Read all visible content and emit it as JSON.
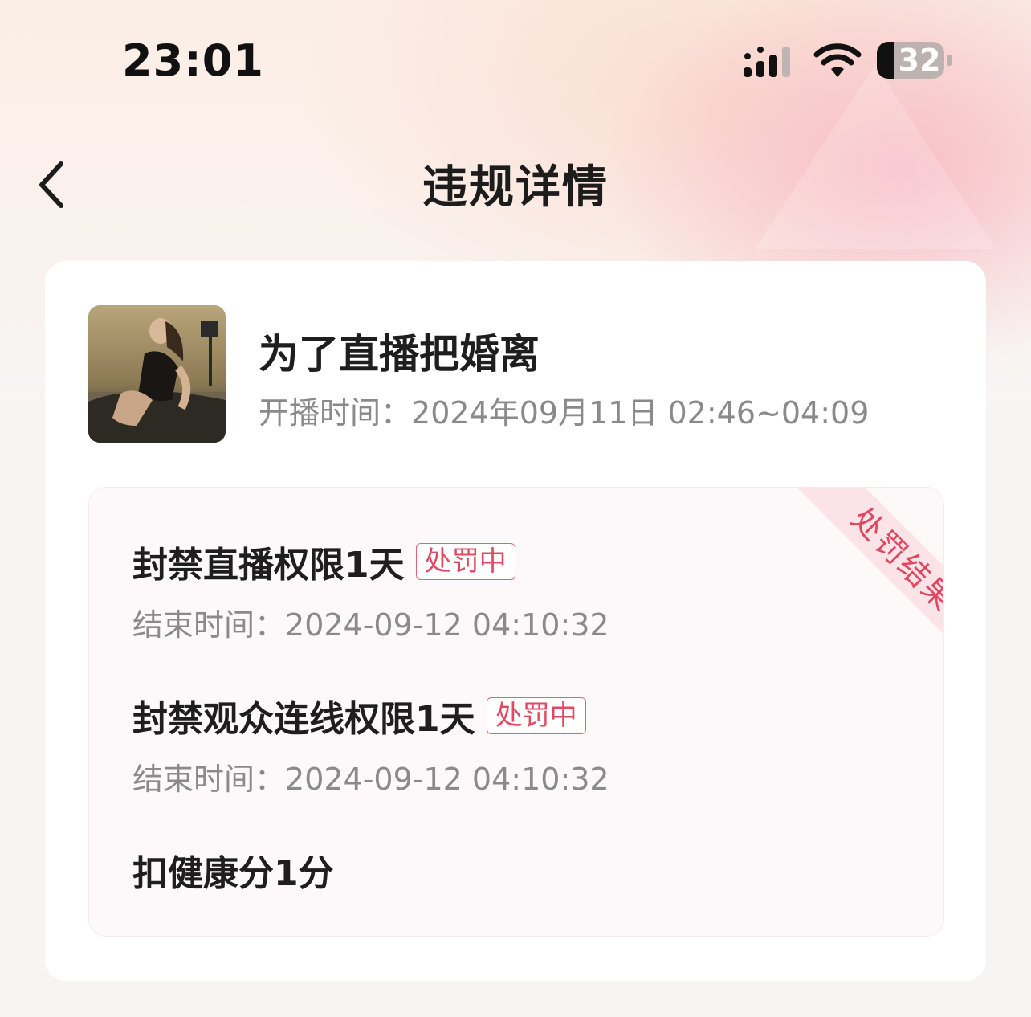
{
  "status_bar": {
    "time": "23:01",
    "battery": "32",
    "icons": [
      "signal-icon",
      "wifi-icon",
      "battery-icon"
    ]
  },
  "nav": {
    "title": "违规详情",
    "back_icon": "chevron-left-icon"
  },
  "stream": {
    "title": "为了直播把婚离",
    "time_label": "开播时间：",
    "time_value": "2024年09月11日 02:46~04:09"
  },
  "result": {
    "ribbon": "处罚结果",
    "penalties": [
      {
        "name": "封禁直播权限1天",
        "badge": "处罚中",
        "end_label": "结束时间：",
        "end_value": "2024-09-12 04:10:32"
      },
      {
        "name": "封禁观众连线权限1天",
        "badge": "处罚中",
        "end_label": "结束时间：",
        "end_value": "2024-09-12 04:10:32"
      },
      {
        "name": "扣健康分1分"
      }
    ]
  },
  "colors": {
    "accent": "#e04a62",
    "ribbon_bg": "#fbe3e8",
    "card_bg": "#ffffff",
    "result_bg": "#fdf8f9"
  }
}
